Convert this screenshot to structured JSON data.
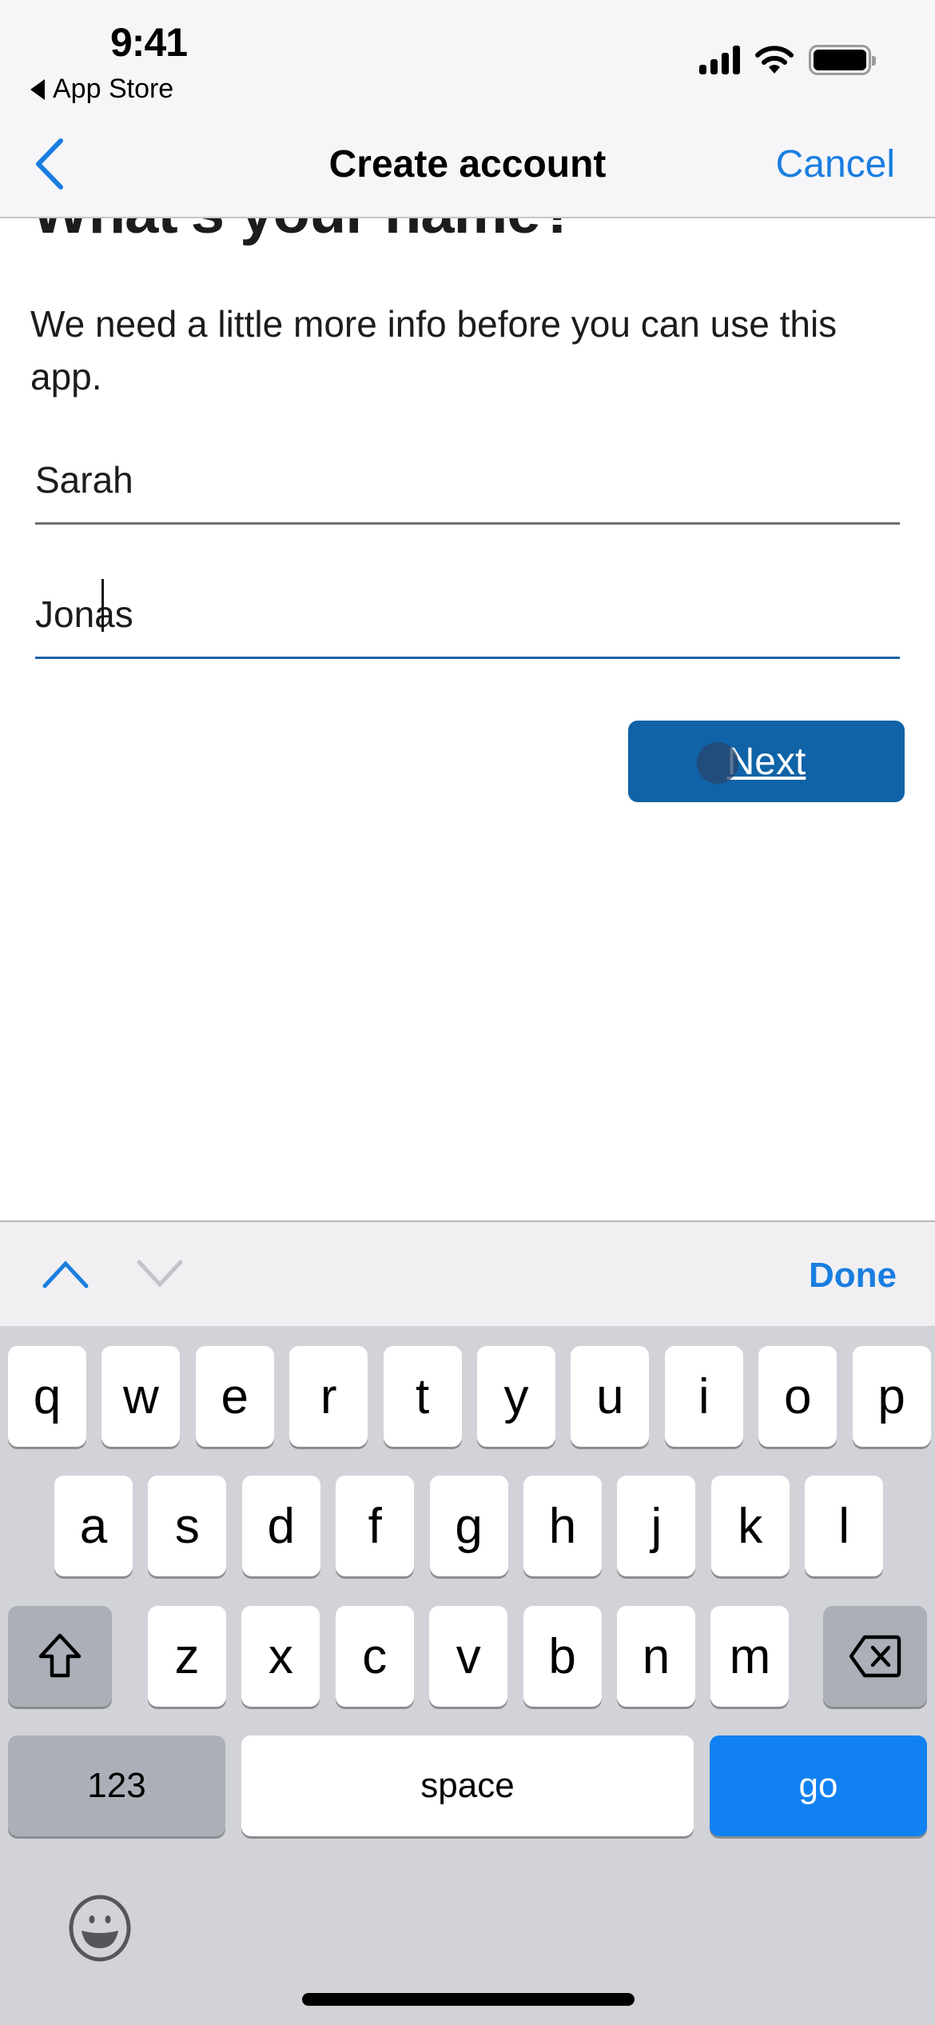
{
  "status_bar": {
    "time": "9:41",
    "back_app_label": "App Store",
    "icons": [
      "cellular-signal-icon",
      "wifi-icon",
      "battery-icon"
    ]
  },
  "nav": {
    "back_icon": "chevron-left-icon",
    "title": "Create account",
    "cancel_label": "Cancel"
  },
  "content": {
    "heading": "What's your name?",
    "subtitle": "We need a little more info before you can use this app.",
    "first_name_value": "Sarah",
    "last_name_value": "Jonas",
    "next_label": "Next"
  },
  "accessory_bar": {
    "prev_icon": "chevron-up-icon",
    "next_icon": "chevron-down-icon",
    "done_label": "Done"
  },
  "keyboard": {
    "row1": [
      "q",
      "w",
      "e",
      "r",
      "t",
      "y",
      "u",
      "i",
      "o",
      "p"
    ],
    "row2": [
      "a",
      "s",
      "d",
      "f",
      "g",
      "h",
      "j",
      "k",
      "l"
    ],
    "row3": [
      "z",
      "x",
      "c",
      "v",
      "b",
      "n",
      "m"
    ],
    "numbers_label": "123",
    "space_label": "space",
    "go_label": "go",
    "shift_icon": "shift-icon",
    "delete_icon": "backspace-icon",
    "emoji_icon": "emoji-icon"
  },
  "colors": {
    "accent": "#1a7ee0",
    "button": "#0f63a6",
    "go_key": "#1181f2"
  }
}
